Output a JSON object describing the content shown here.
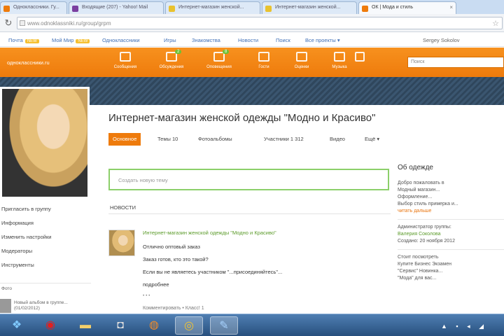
{
  "browser": {
    "tabs": [
      {
        "label": "Одноклассники. Гу...",
        "fav_color": "#ee7b0c"
      },
      {
        "label": "Входящие (207) - Yahoo! Mail",
        "fav_color": "#7b3fa0"
      },
      {
        "label": "Интернет-магазин женской...",
        "fav_color": "#e9c22e"
      },
      {
        "label": "Интернет-магазин женской...",
        "fav_color": "#e9c22e"
      },
      {
        "label": "ОК | Мода и стиль",
        "fav_color": "#ee7b0c"
      }
    ],
    "url": "www.odnoklassniki.ru/group/grpm",
    "reload_glyph": "↻",
    "star_glyph": "☆",
    "close_glyph": "×"
  },
  "portal_links": [
    {
      "label": "Почта",
      "badge": "NEW"
    },
    {
      "label": "Мой Мир",
      "badge": "NEW"
    },
    {
      "label": "Одноклассники",
      "badge": ""
    },
    {
      "label": "Игры",
      "badge": ""
    },
    {
      "label": "Знакомства",
      "badge": ""
    },
    {
      "label": "Новости",
      "badge": ""
    },
    {
      "label": "Поиск",
      "badge": ""
    },
    {
      "label": "Все проекты ▾",
      "badge": ""
    }
  ],
  "portal_user": "Sergey Sokolov",
  "header": {
    "brand": "одноклассники.ru",
    "nav": [
      {
        "label": "Сообщения",
        "icon": "envelope-icon",
        "count": ""
      },
      {
        "label": "Обсуждения",
        "icon": "chat-icon",
        "count": "2"
      },
      {
        "label": "Оповещения",
        "icon": "bell-icon",
        "count": "8"
      },
      {
        "label": "Гости",
        "icon": "footprints-icon",
        "count": ""
      },
      {
        "label": "Оценки",
        "icon": "star-icon",
        "count": ""
      },
      {
        "label": "Музыка",
        "icon": "music-icon",
        "count": ""
      },
      {
        "label": "",
        "icon": "down-arrow-icon",
        "count": ""
      }
    ],
    "search_placeholder": "Поиск"
  },
  "left_menu": [
    "Пригласить в группу",
    "Информация",
    "Изменить настройки",
    "Модераторы",
    "Инструменты"
  ],
  "left_footer": {
    "heading": "Фото",
    "text": "Новый альбом в группе...",
    "date": "(01/02/2012)"
  },
  "group": {
    "title": "Интернет-магазин женской одежды \"Модно и Красиво\"",
    "tabs": [
      {
        "label": "Основное",
        "active": true
      },
      {
        "label": "Темы 10",
        "active": false
      },
      {
        "label": "Фотоальбомы",
        "active": false
      },
      {
        "label": "Участники 1 312",
        "active": false
      },
      {
        "label": "Видео",
        "active": false
      },
      {
        "label": "Ещё ▾",
        "active": false
      }
    ],
    "new_topic_placeholder": "Создать новую тему",
    "news_heading": "Новости"
  },
  "post": {
    "author": "Интернет-магазин женской одежды \"Модно и Красиво\"",
    "lines": [
      "Отлично оптовый заказ",
      "Заказ готов, кто это такой?",
      "Если вы не являетесь участником \"...присоединяйтесь\"...",
      "подробнее"
    ],
    "more": "• • •",
    "footer": "Комментировать • Класс! 1"
  },
  "right_column": {
    "title": "Об одежде",
    "about_lines": [
      "Добро пожаловать в",
      "Модный магазин...",
      "Оформление...",
      "Выбор стиль примерка и...",
      "читать дальше"
    ],
    "created_label": "Администратор группы:",
    "admin_name": "Валерия Соколова",
    "created_date": "Создано: 20 ноября 2012",
    "other_title": "Стоит посмотреть",
    "other_lines": [
      "Купите Бизнес Экзамен",
      "\"Сервис\" Новинка...",
      "\"Мода\" для вас..."
    ]
  },
  "taskbar": {
    "apps": [
      {
        "name": "windows-start-icon",
        "glyph": "❖",
        "color": "#7fc9ff",
        "active": false
      },
      {
        "name": "opera-icon",
        "glyph": "◉",
        "color": "#e02020",
        "active": false
      },
      {
        "name": "folder-icon",
        "glyph": "▬",
        "color": "#f2cf6b",
        "active": false
      },
      {
        "name": "camera-icon",
        "glyph": "◘",
        "color": "#dddddd",
        "active": false
      },
      {
        "name": "media-player-icon",
        "glyph": "◍",
        "color": "#f28c28",
        "active": false
      },
      {
        "name": "chrome-icon",
        "glyph": "◎",
        "color": "#f4c430",
        "active": true
      },
      {
        "name": "paint-icon",
        "glyph": "✎",
        "color": "#a8d3ff",
        "active": true
      }
    ],
    "tray": "▲ ▪ ◂ ◢"
  }
}
